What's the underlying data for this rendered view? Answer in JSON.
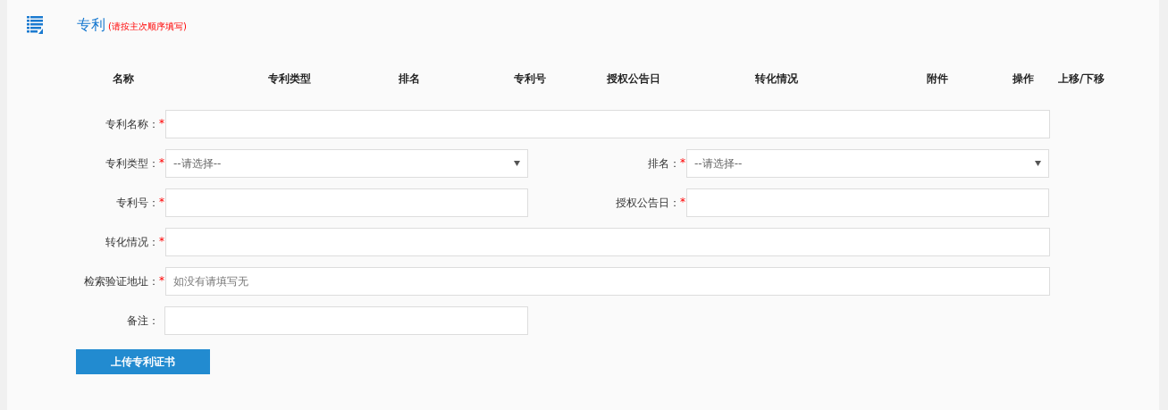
{
  "section": {
    "title": "专利",
    "note": "(请按主次顺序填写)"
  },
  "table": {
    "columns": [
      "名称",
      "专利类型",
      "排名",
      "专利号",
      "授权公告日",
      "转化情况",
      "附件",
      "操作",
      "上移/下移"
    ]
  },
  "form": {
    "rows": [
      [
        {
          "kind": "text",
          "label": "专利名称：",
          "required_mark": "*"
        }
      ],
      [
        {
          "kind": "select",
          "label": "专利类型：",
          "required_mark": "*",
          "value": "--请选择--"
        },
        {
          "kind": "select",
          "label": "排名：",
          "required_mark": "*",
          "value": "--请选择--"
        }
      ],
      [
        {
          "kind": "text",
          "label": "专利号：",
          "required_mark": "*"
        },
        {
          "kind": "text",
          "label": "授权公告日：",
          "required_mark": "*"
        }
      ],
      [
        {
          "kind": "text",
          "label": "转化情况：",
          "required_mark": "*"
        }
      ],
      [
        {
          "kind": "text",
          "label": "检索验证地址：",
          "required_mark": "*",
          "placeholder": "如没有请填写无"
        }
      ],
      [
        {
          "kind": "text",
          "label": "备注："
        }
      ]
    ]
  },
  "upload_button": "上传专利证书"
}
